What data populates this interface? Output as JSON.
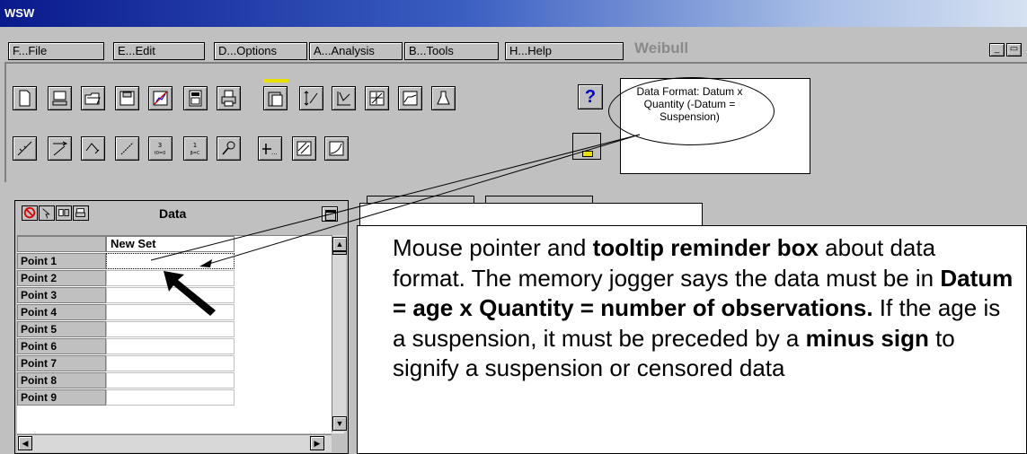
{
  "window": {
    "title": "WSW"
  },
  "menu": {
    "items": [
      {
        "label": "F...File"
      },
      {
        "label": "E...Edit"
      },
      {
        "label": "D...Options"
      },
      {
        "label": "A...Analysis"
      },
      {
        "label": "B...Tools"
      },
      {
        "label": "H...Help"
      }
    ],
    "app_name": "Weibull"
  },
  "window_controls": {
    "minimize": "_",
    "restore": "▭"
  },
  "toolbar": {
    "help_label": "?",
    "row1_icons": [
      "new-file-icon",
      "computer-icon",
      "open-folder-icon",
      "save-icon",
      "plot-icon",
      "calculator-icon",
      "printer-icon",
      "paste-icon",
      "scale-icon",
      "distribution-icon",
      "grid-plot-icon",
      "line-chart-icon",
      "flask-icon"
    ],
    "row2_icons": [
      "fit-line-icon",
      "arrows-icon",
      "curve-icon",
      "diagonal-icon",
      "t0-icon",
      "beta-icon",
      "magnifier-icon",
      "add-icon",
      "hatch-icon",
      "curve-fit-icon"
    ]
  },
  "tooltip": {
    "text": "Data Format: Datum x Quantity (-Datum = Suspension)"
  },
  "data_panel": {
    "title": "Data",
    "column_header": "New Set",
    "rows": [
      "Point 1",
      "Point 2",
      "Point 3",
      "Point 4",
      "Point 5",
      "Point 6",
      "Point 7",
      "Point 8",
      "Point 9"
    ]
  },
  "callout": {
    "p1": "Mouse pointer and ",
    "b1": "tooltip reminder box",
    "p2": " about data format.   The memory jogger says the data must be in ",
    "b2": "Datum = age x Quantity = number of observations.",
    "p3": "  If the age is a suspension, it must be preceded by a ",
    "b3": "minus sign",
    "p4": " to signify a suspension or censored data"
  },
  "colors": {
    "title_gradient_start": "#0a1a8c",
    "frame": "#c0c0c0",
    "help_accent": "#0000cc"
  }
}
